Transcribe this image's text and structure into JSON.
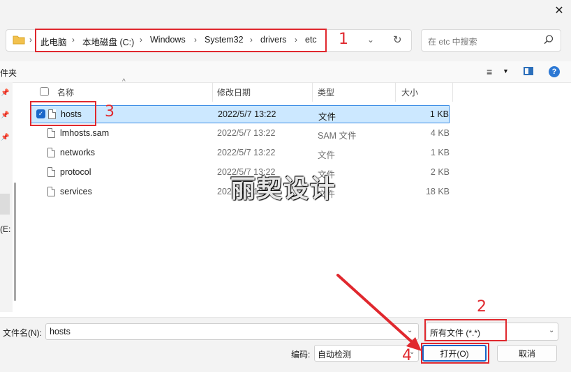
{
  "titlebar": {
    "close_glyph": "✕"
  },
  "address": {
    "breadcrumb": [
      "此电脑",
      "本地磁盘 (C:)",
      "Windows",
      "System32",
      "drivers",
      "etc"
    ],
    "separator": "›",
    "dropdown_glyph": "⌄",
    "refresh_glyph": "↻"
  },
  "search": {
    "placeholder": "在 etc 中搜索"
  },
  "toolbar": {
    "left_text": "件夹",
    "view_glyph": "≡",
    "view_dropdown": "▼",
    "help_glyph": "?"
  },
  "nav": {
    "pin_glyph": "📌",
    "partial_text": "(E:"
  },
  "columns": {
    "sort_glyph": "^",
    "name": "名称",
    "date": "修改日期",
    "type": "类型",
    "size": "大小"
  },
  "files": [
    {
      "name": "hosts",
      "date": "2022/5/7 13:22",
      "type": "文件",
      "size": "1 KB",
      "selected": true
    },
    {
      "name": "lmhosts.sam",
      "date": "2022/5/7 13:22",
      "type": "SAM 文件",
      "size": "4 KB",
      "selected": false
    },
    {
      "name": "networks",
      "date": "2022/5/7 13:22",
      "type": "文件",
      "size": "1 KB",
      "selected": false
    },
    {
      "name": "protocol",
      "date": "2022/5/7 13:22",
      "type": "文件",
      "size": "2 KB",
      "selected": false
    },
    {
      "name": "services",
      "date": "2022/5/7 13:22",
      "type": "文件",
      "size": "18 KB",
      "selected": false
    }
  ],
  "check_glyph": "✓",
  "watermark": "丽契设计",
  "bottom": {
    "filename_label": "文件名(N):",
    "filename_value": "hosts",
    "filter_value": "所有文件  (*.*)",
    "encoding_label": "编码:",
    "encoding_value": "自动检测",
    "dropdown_glyph": "⌄",
    "open_label": "打开(O)",
    "cancel_label": "取消"
  },
  "annotations": [
    "1",
    "2",
    "3",
    "4"
  ],
  "colors": {
    "annotation_red": "#e0282e",
    "selection": "#cce8ff",
    "accent": "#1a67c9"
  }
}
